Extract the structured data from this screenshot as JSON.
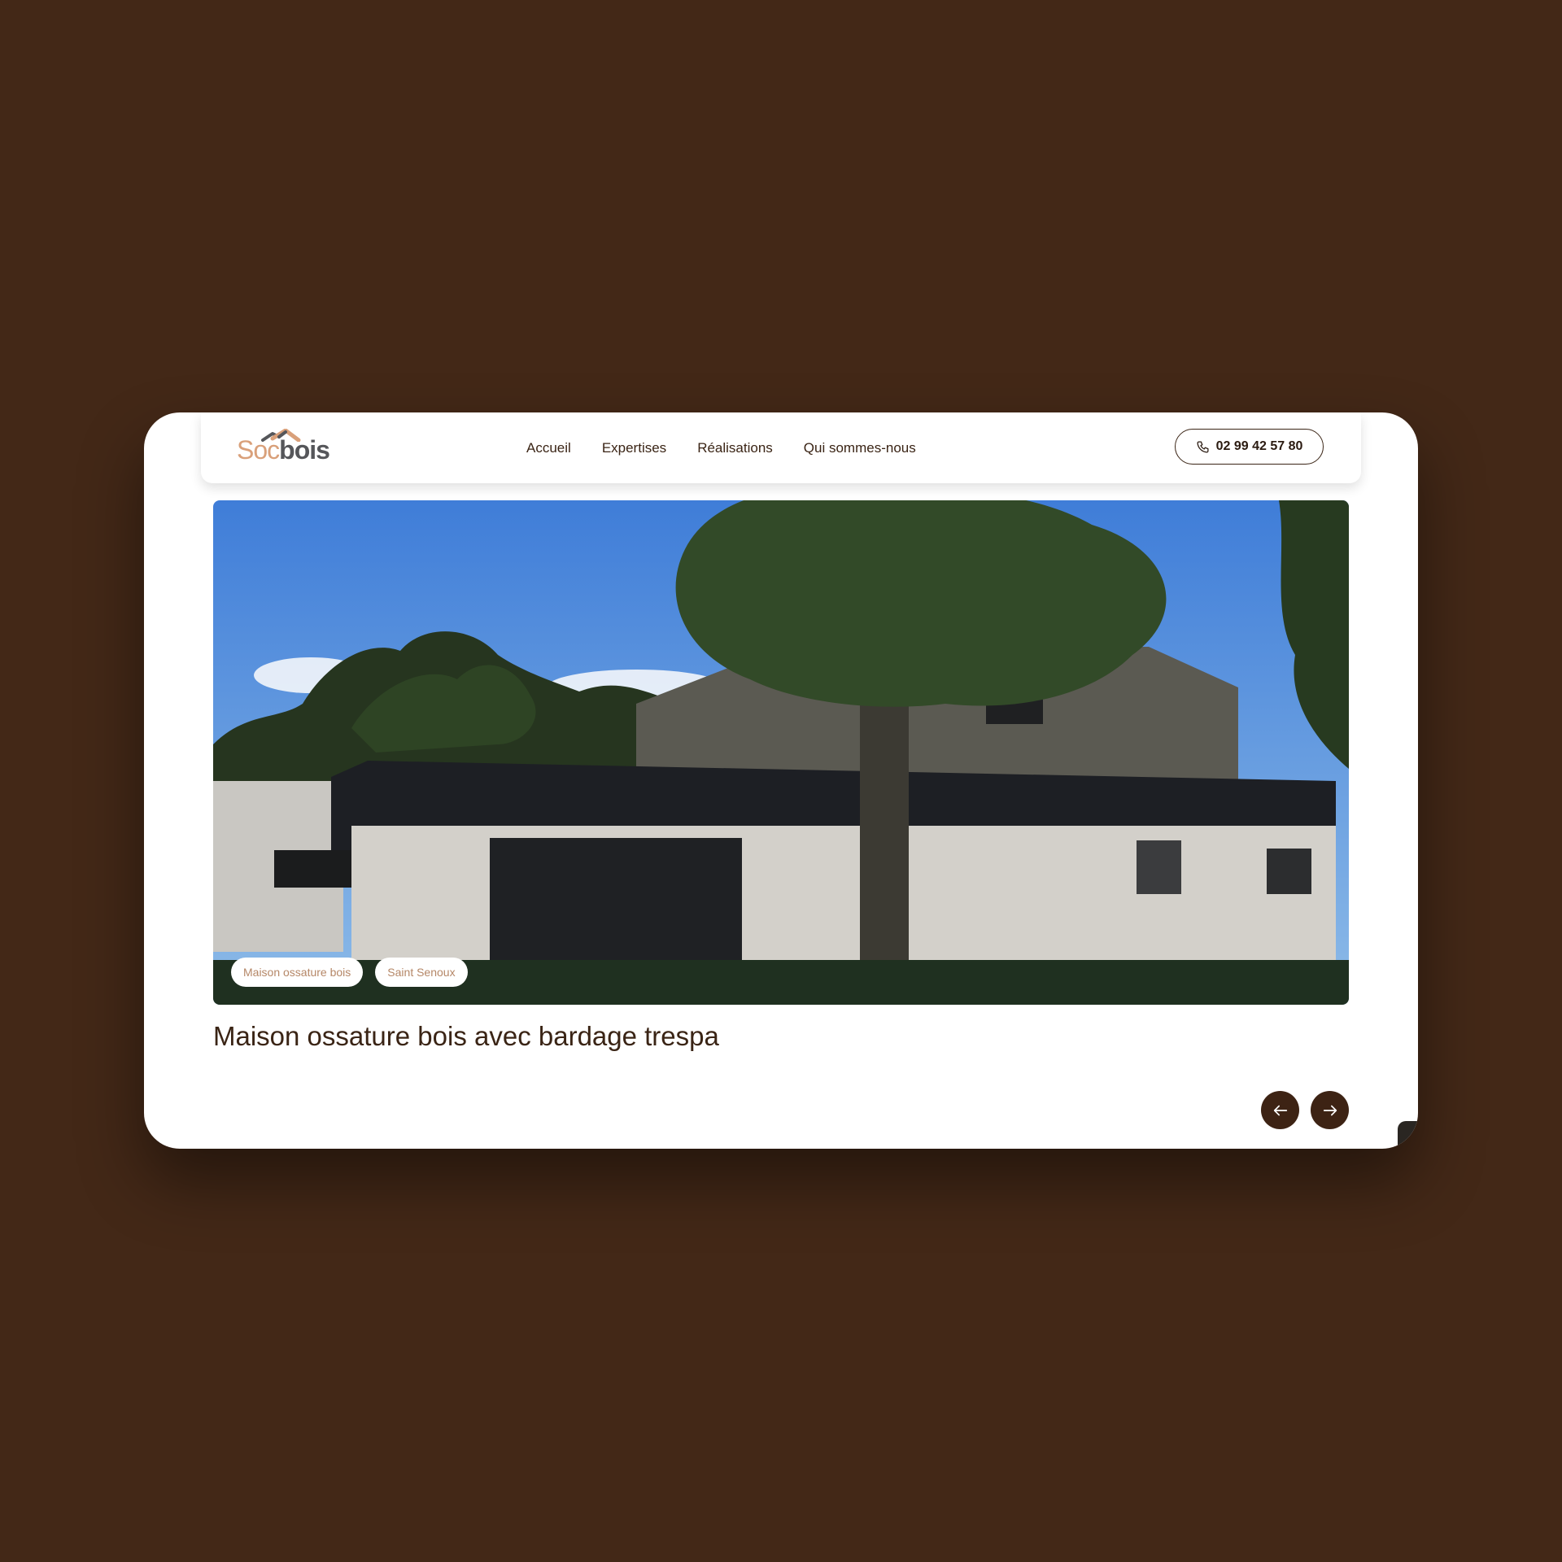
{
  "brand": {
    "logo_part1": "Soc",
    "logo_part2": "bois",
    "color_light": "#d9a07a",
    "color_dark": "#55565a"
  },
  "nav": {
    "links": [
      {
        "label": "Accueil"
      },
      {
        "label": "Expertises"
      },
      {
        "label": "Réalisations"
      },
      {
        "label": "Qui sommes-nous"
      }
    ],
    "phone": "02 99 42 57 80"
  },
  "project": {
    "tags": [
      "Maison ossature bois",
      "Saint Senoux"
    ],
    "title": "Maison ossature bois avec bardage trespa"
  },
  "icons": {
    "phone": "phone-icon",
    "prev": "arrow-left-icon",
    "next": "arrow-right-icon"
  },
  "colors": {
    "background": "#432817",
    "accent_dark": "#3d2314",
    "tag_text": "#b58767"
  }
}
